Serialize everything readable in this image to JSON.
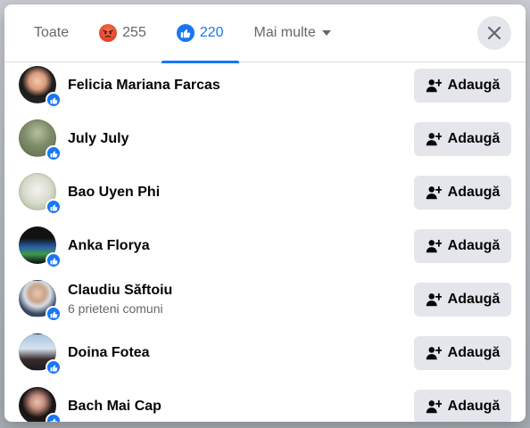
{
  "dialog": {
    "tabs": [
      {
        "label": "Toate",
        "active": false
      },
      {
        "label": "255",
        "icon": "angry-reaction-icon",
        "active": false
      },
      {
        "label": "220",
        "icon": "like-reaction-icon",
        "active": true
      },
      {
        "label": "Mai multe",
        "icon": "caret-down-icon",
        "active": false
      }
    ],
    "close_icon": "close-icon"
  },
  "people": [
    {
      "name": "Felicia Mariana Farcas",
      "subtitle": "",
      "button": "Adaugă"
    },
    {
      "name": "July July",
      "subtitle": "",
      "button": "Adaugă"
    },
    {
      "name": "Bao Uyen Phi",
      "subtitle": "",
      "button": "Adaugă"
    },
    {
      "name": "Anka Florya",
      "subtitle": "",
      "button": "Adaugă"
    },
    {
      "name": "Claudiu Săftoiu",
      "subtitle": "6 prieteni comuni",
      "button": "Adaugă"
    },
    {
      "name": "Doina Fotea",
      "subtitle": "",
      "button": "Adaugă"
    },
    {
      "name": "Bach Mai Cap",
      "subtitle": "",
      "button": "Adaugă"
    }
  ],
  "colors": {
    "accent": "#1877f2",
    "button_bg": "#e4e6eb",
    "secondary_text": "#65676b"
  }
}
